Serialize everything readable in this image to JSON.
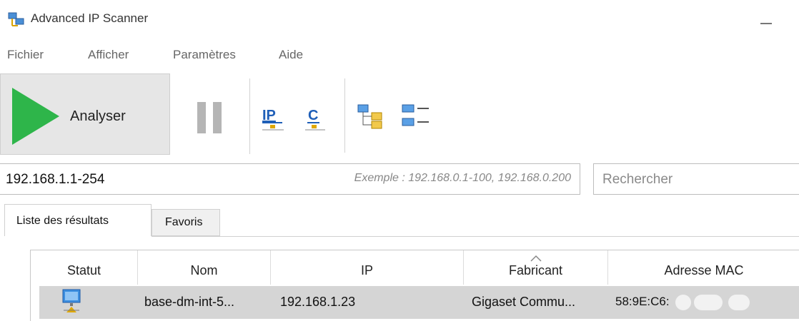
{
  "window": {
    "title": "Advanced IP Scanner",
    "icon": "network-computers-icon"
  },
  "menu": [
    "Fichier",
    "Afficher",
    "Paramètres",
    "Aide"
  ],
  "toolbar": {
    "scan_label": "Analyser",
    "buttons": [
      {
        "name": "pause-icon"
      },
      {
        "name": "ip-icon",
        "text": "IP"
      },
      {
        "name": "c-icon",
        "text": "C"
      },
      {
        "name": "tree-view-icon"
      },
      {
        "name": "list-view-icon"
      }
    ],
    "accent": "#2eb54a"
  },
  "range": {
    "value": "192.168.1.1-254",
    "hint": "Exemple : 192.168.0.1-100, 192.168.0.200"
  },
  "search": {
    "placeholder": "Rechercher"
  },
  "tabs": [
    "Liste des résultats",
    "Favoris"
  ],
  "table": {
    "columns": [
      "Statut",
      "Nom",
      "IP",
      "Fabricant",
      "Adresse MAC"
    ],
    "sorted_column": "Fabricant",
    "rows": [
      {
        "status_icon": "computer-online-icon",
        "name": "base-dm-int-5...",
        "ip": "192.168.1.23",
        "vendor": "Gigaset Commu...",
        "mac": "58:9E:C6:"
      }
    ]
  }
}
